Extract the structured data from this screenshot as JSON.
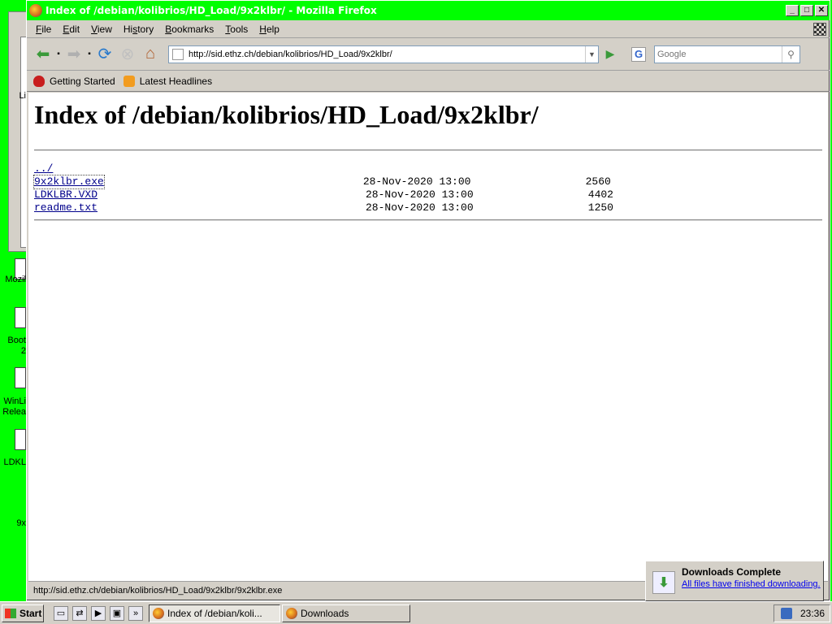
{
  "window": {
    "title": "Index of /debian/kolibrios/HD_Load/9x2klbr/ - Mozilla Firefox",
    "minimize": "_",
    "maximize": "□",
    "close": "✕"
  },
  "menu": {
    "items": [
      {
        "ul": "F",
        "rest": "ile"
      },
      {
        "ul": "E",
        "rest": "dit"
      },
      {
        "ul": "V",
        "rest": "iew"
      },
      {
        "ul": "",
        "rest": "Hi",
        "ul2": "s",
        "rest2": "tory"
      },
      {
        "ul": "B",
        "rest": "ookmarks"
      },
      {
        "ul": "T",
        "rest": "ools"
      },
      {
        "ul": "H",
        "rest": "elp"
      }
    ]
  },
  "nav": {
    "url": "http://sid.ethz.ch/debian/kolibrios/HD_Load/9x2klbr/",
    "search_placeholder": "Google",
    "search_engine_letter": "G"
  },
  "bookmarks": {
    "items": [
      "Getting Started",
      "Latest Headlines"
    ]
  },
  "page": {
    "heading": "Index of /debian/kolibrios/HD_Load/9x2klbr/",
    "parent": "../",
    "files": [
      {
        "name": "9x2klbr.exe",
        "date": "28-Nov-2020 13:00",
        "size": "2560"
      },
      {
        "name": "LDKLBR.VXD",
        "date": "28-Nov-2020 13:00",
        "size": "4402"
      },
      {
        "name": "readme.txt",
        "date": "28-Nov-2020 13:00",
        "size": "1250"
      }
    ]
  },
  "status": {
    "text": "http://sid.ethz.ch/debian/kolibrios/HD_Load/9x2klbr/9x2klbr.exe"
  },
  "downloads_popup": {
    "title": "Downloads Complete",
    "link": "All files have finished downloading."
  },
  "taskbar": {
    "start": "Start",
    "tasks": [
      "Index of /debian/koli...",
      "Downloads"
    ],
    "clock": "23:36"
  },
  "desktop": {
    "labels": [
      "Li",
      "Mozil",
      "Boot",
      "2",
      "WinLi",
      "Relea",
      "LDKL",
      "9x"
    ]
  }
}
